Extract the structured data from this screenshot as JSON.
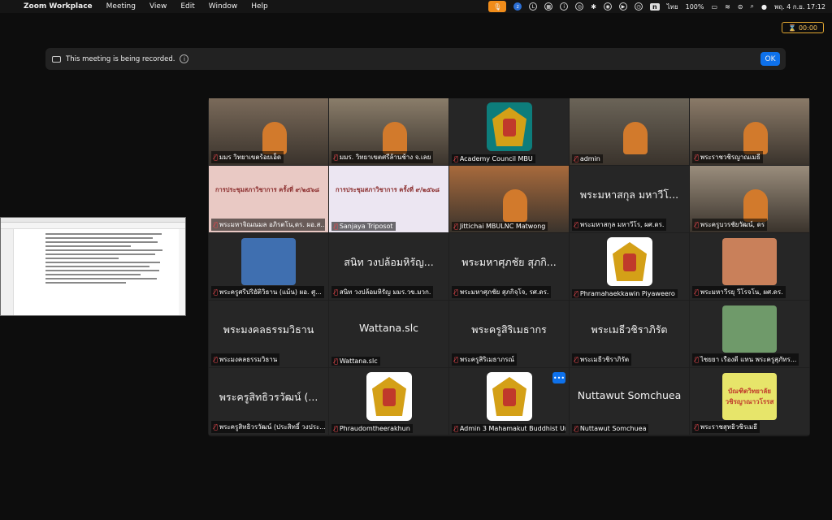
{
  "menubar": {
    "apple_icon": "apple-logo",
    "app_name": "Zoom Workplace",
    "menus": [
      "Meeting",
      "View",
      "Edit",
      "Window",
      "Help"
    ],
    "input_lang": "ไทย",
    "battery": "100%",
    "clock": "พฤ. 4 ก.ย.  17:12"
  },
  "timer": {
    "value": "00:00"
  },
  "recording_banner": {
    "text": "This meeting is being recorded.",
    "ok_label": "OK"
  },
  "tiles": [
    {
      "name": "มมร วิทยาเขตร้อยเอ็ด",
      "type": "video",
      "bg": "#7a6a5a"
    },
    {
      "name": "มมร. วิทยาเขตศรีล้านช้าง จ.เลย",
      "type": "video",
      "bg": "#8a7d6a"
    },
    {
      "name": "Academy Council MBU",
      "type": "logo",
      "bg": "#262626"
    },
    {
      "name": "admin",
      "type": "video",
      "bg": "#6b6458",
      "active": true
    },
    {
      "name": "พระราชวชิรญาณเมธี",
      "type": "video",
      "bg": "#8a7a68"
    },
    {
      "name": "พระมหาจิณณมล อภิรตโน,ดร. ผอ.ส...",
      "type": "slide",
      "bg": "#e9c9c4",
      "slide_title": "การประชุมสภาวิชาการ ครั้งที่ ๙/๒๕๖๘"
    },
    {
      "name": "Sanjaya Triposot",
      "type": "slide",
      "bg": "#ece6f2",
      "slide_title": "การประชุมสภาวิชาการ ครั้งที่ ๙/๒๕๖๘"
    },
    {
      "name": "Jittichai MBULNC Matwong",
      "type": "video",
      "bg": "#a86a3c"
    },
    {
      "name": "พระมหาสกุล มหาวีโร, ผศ.ดร.",
      "type": "text",
      "big": "พระมหาสกุล มหาวีโ..."
    },
    {
      "name": "พระครูบวรชัยวัฒน์, ดร",
      "type": "video",
      "bg": "#9a8d7c"
    },
    {
      "name": "พระครูศรีปริยัติวิธาน (แม้น) ผอ. ศู...",
      "type": "picture",
      "bg": "#3f6fb0"
    },
    {
      "name": "สนิท  วงปล้อมหิรัญ มมร.วข.มวก.",
      "type": "text",
      "big": "สนิท  วงปล้อมหิรัญ..."
    },
    {
      "name": "พระมหาศุภชัย สุภกิจฺโจ, รศ.ดร.",
      "type": "text",
      "big": "พระมหาศุภชัย สุภกิ..."
    },
    {
      "name": "Phramahaekkawin Piyaweero",
      "type": "logo",
      "bg": "#262626"
    },
    {
      "name": "พระมหาวีรยุ วีโรจโน, ผศ.ดร.",
      "type": "picture",
      "bg": "#c9805a"
    },
    {
      "name": "พระมงคลธรรมวิธาน",
      "type": "text",
      "big": "พระมงคลธรรมวิธาน"
    },
    {
      "name": "Wattana.slc",
      "type": "text",
      "big": "Wattana.slc"
    },
    {
      "name": "พระครูสิริเมธาภรณ์",
      "type": "text",
      "big": "พระครูสิริเมธากร"
    },
    {
      "name": "พระเมธีวชิราภิรัต",
      "type": "text",
      "big": "พระเมธีวชิราภิรัต"
    },
    {
      "name": "ไชยยา  เรืองดี  แทน  พระครูสุภัทร...",
      "type": "picture",
      "bg": "#6f9a6a"
    },
    {
      "name": "พระครูสิทธิวรวัฒน์ (ประสิทธิ์ วงประ...",
      "type": "text",
      "big": "พระครูสิทธิวรวัฒน์ (..."
    },
    {
      "name": "Phraudomtheerakhun",
      "type": "logo",
      "bg": "#262626"
    },
    {
      "name": "Admin 3 Mahamakut Buddhist Un...",
      "type": "logo",
      "bg": "#262626"
    },
    {
      "name": "Nuttawut Somchuea",
      "type": "text",
      "big": "Nuttawut Somchuea"
    },
    {
      "name": "พระราชสุทธิวชิรเมธี",
      "type": "picture",
      "bg": "#e7e56a",
      "pic_text": "บัณฑิตวิทยาลัย วชิรญาณาวโรรส"
    }
  ]
}
